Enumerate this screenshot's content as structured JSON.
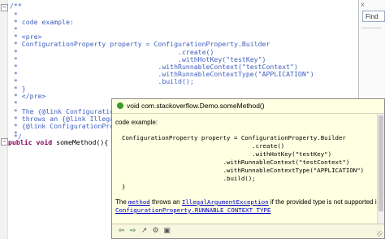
{
  "editor": {
    "lines": [
      "/**",
      " *",
      " * code example:",
      " *",
      " * <pre>",
      " * ConfigurationProperty property = ConfigurationProperty.Builder",
      " *                                        .create()",
      " *                                        .withHotKey(\"testKey\")",
      " *                                   .withRunnableContext(\"testContext\")",
      " *                                   .withRunnableContextType(\"APPLICATION\")",
      " *                                   .build();",
      " * }",
      " * </pre>",
      " *",
      " * The {@link ConfigurationProp",
      " * throws an {@link IllegalArgu",
      " * {@link ConfigurationProperty",
      " *",
      " */"
    ],
    "method_keywords": "public void",
    "method_signature": " someMethod(){ }"
  },
  "right_pane": {
    "find_label": "Find",
    "close_glyph": "x"
  },
  "hover": {
    "title": "void com.stackoverflow.Demo.someMethod()",
    "intro": "code example:",
    "code_lines": [
      "ConfigurationProperty property = ConfigurationProperty.Builder",
      "                                    .create()",
      "                                    .withHotKey(\"testKey\")",
      "                            .withRunnableContext(\"testContext\")",
      "                            .withRunnableContextType(\"APPLICATION\")",
      "                            .build();",
      "}"
    ],
    "desc_the": "The ",
    "desc_method": "method",
    "desc_mid": " throws an ",
    "desc_exception": "IllegalArgumentException",
    "desc_end": " if the provided type is not supported in",
    "desc_constant": "ConfigurationProperty.RUNNABLE_CONTEXT_TYPE",
    "nav_back": "⇦",
    "nav_forward": "⇨",
    "nav_extra": [
      "↗",
      "⚙",
      "▣"
    ]
  }
}
